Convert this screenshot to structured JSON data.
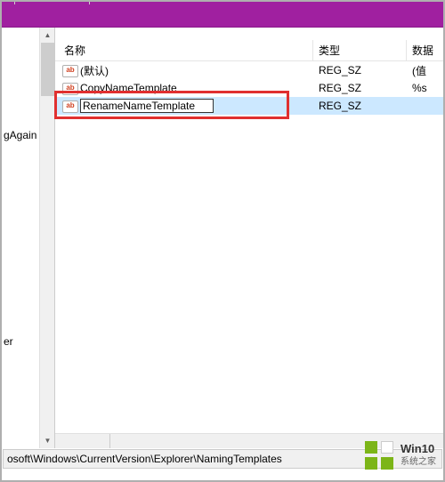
{
  "columns": {
    "name": "名称",
    "type": "类型",
    "data": "数据"
  },
  "rows": [
    {
      "name": "(默认)",
      "type": "REG_SZ",
      "data": "(值"
    },
    {
      "name": "CopyNameTemplate",
      "type": "REG_SZ",
      "data": "%s"
    },
    {
      "name": "RenameNameTemplate",
      "type": "REG_SZ",
      "data": ""
    }
  ],
  "edit_value": "RenameNameTemplate",
  "tree": {
    "item1": "gAgain",
    "item2": "er"
  },
  "status_path": "osoft\\Windows\\CurrentVersion\\Explorer\\NamingTemplates",
  "watermark": {
    "line1": "Win10",
    "line2": "系统之家"
  }
}
